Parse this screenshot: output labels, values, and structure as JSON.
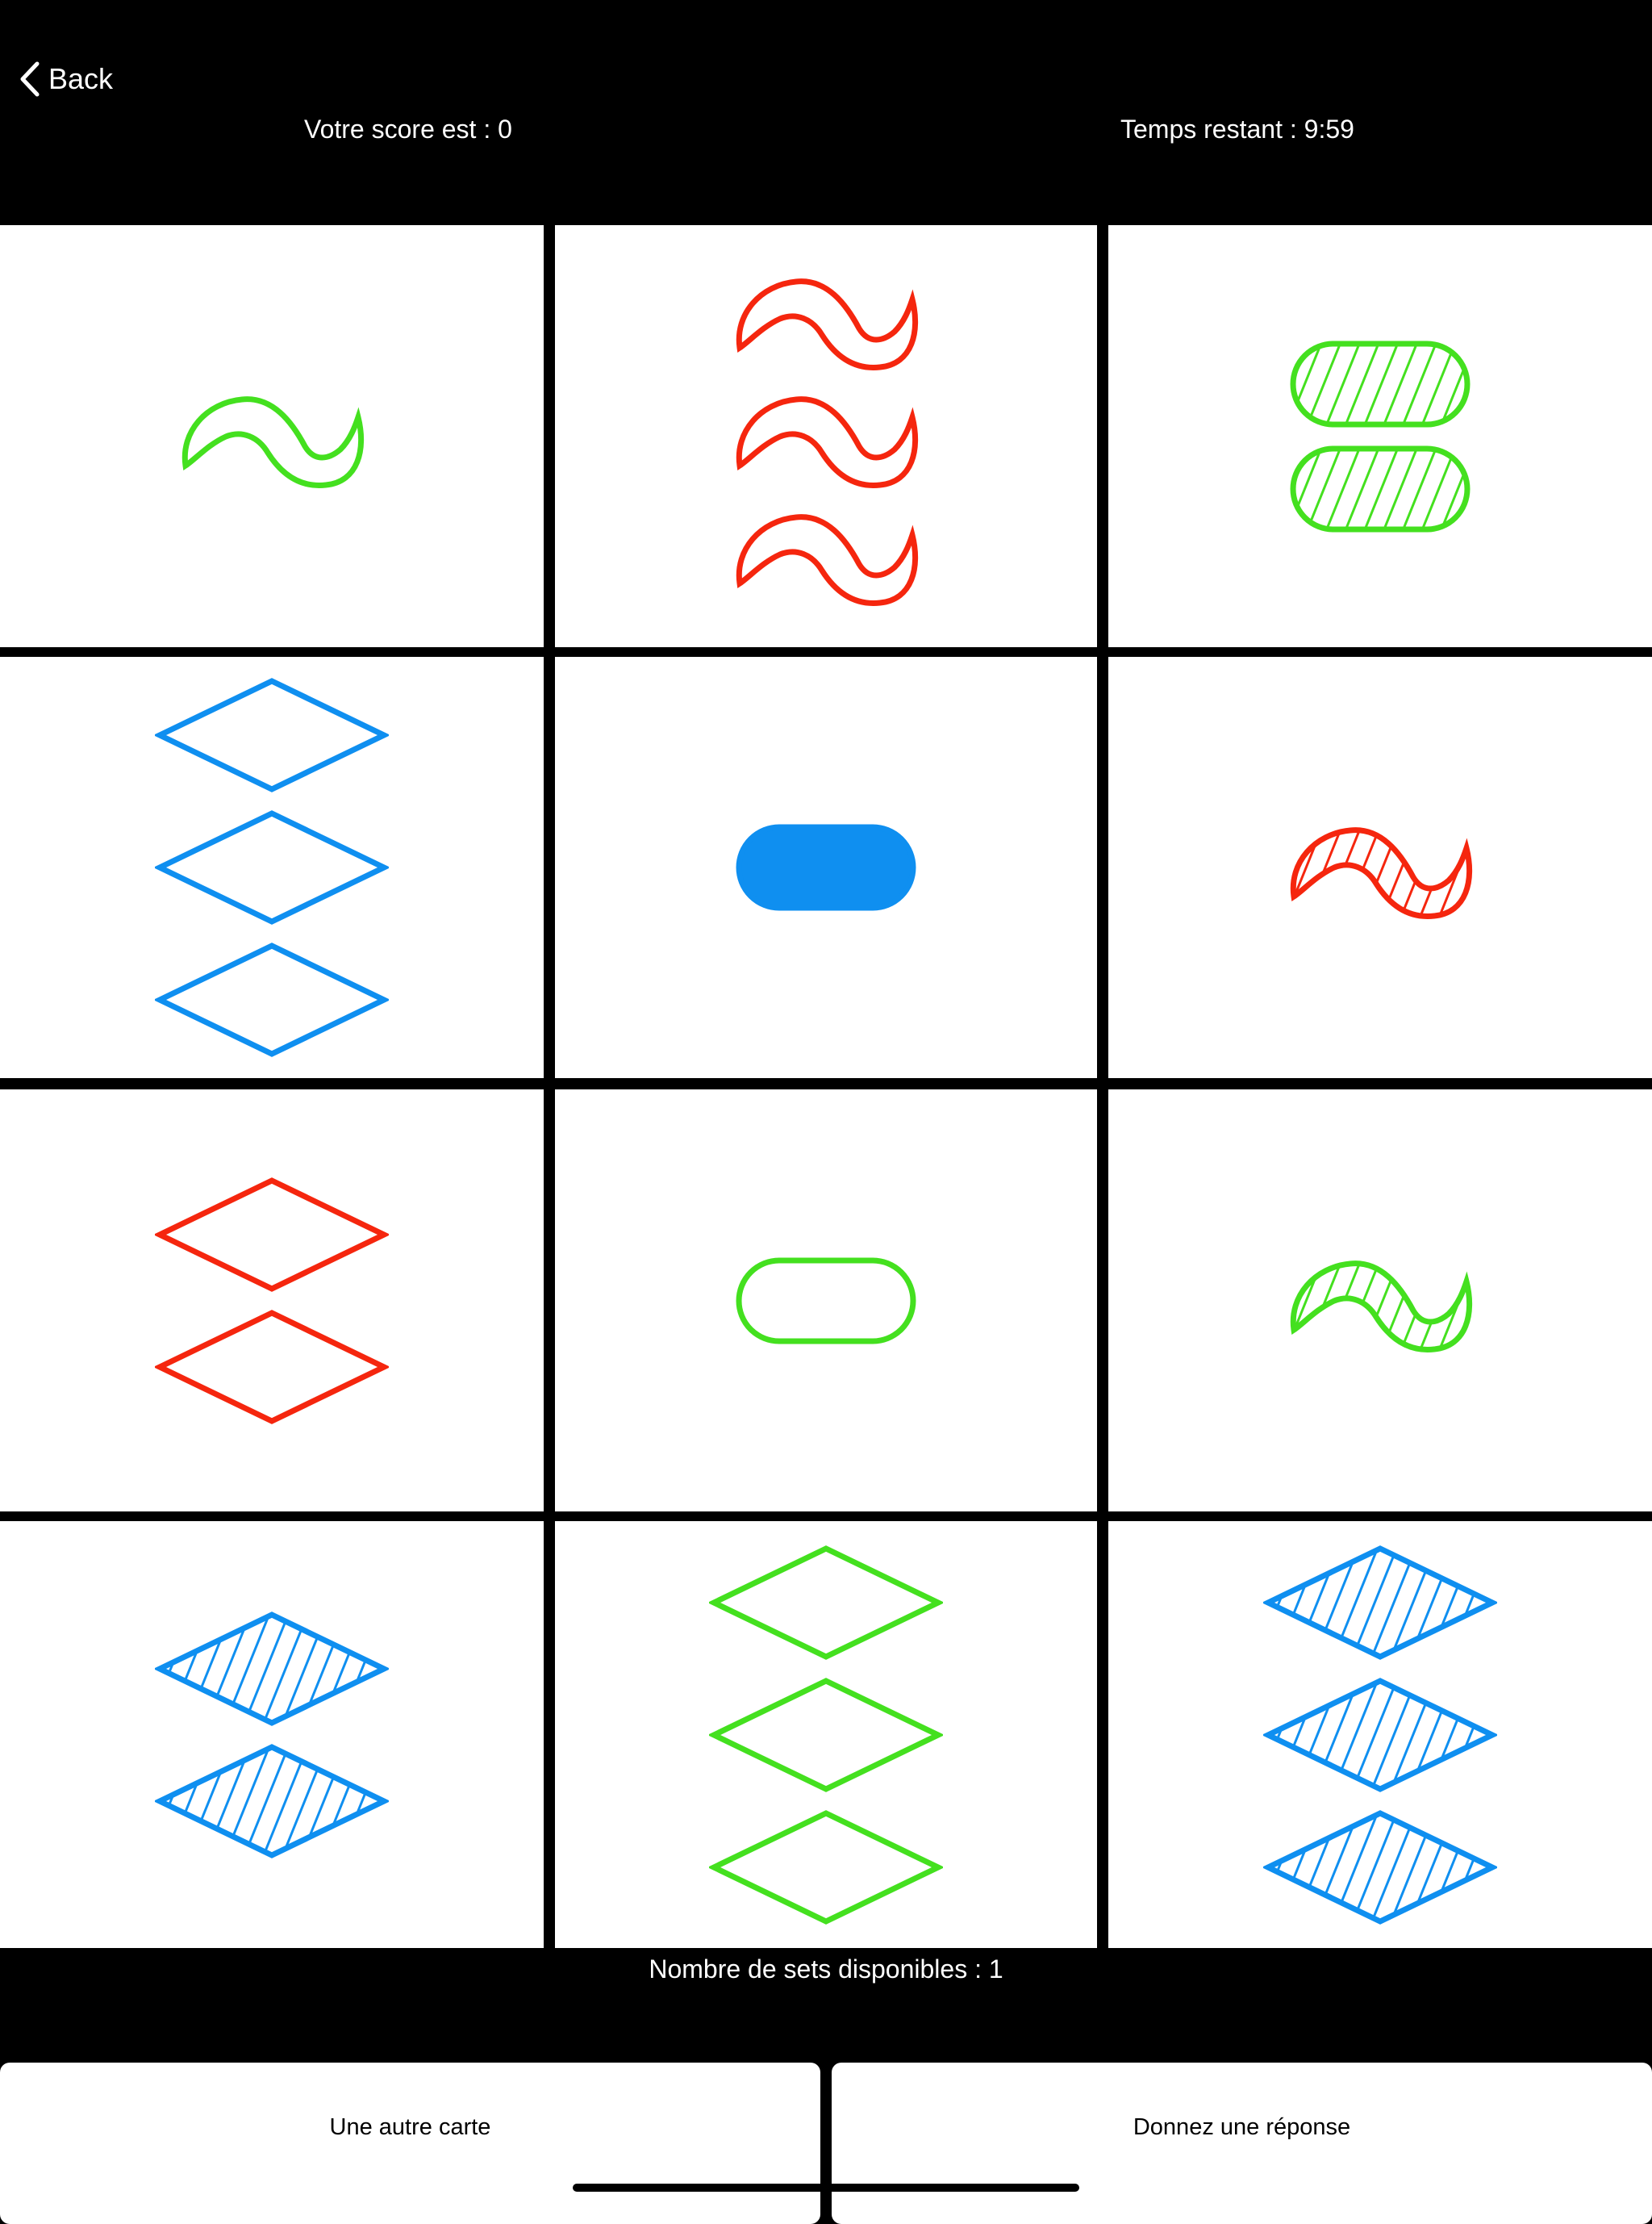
{
  "nav": {
    "back_label": "Back"
  },
  "header": {
    "score_text": "Votre score est : 0",
    "time_text": "Temps restant : 9:59"
  },
  "colors": {
    "green": "#44e01f",
    "red": "#f5260e",
    "blue": "#0f8ff0"
  },
  "cards": [
    {
      "count": 1,
      "shape": "squiggle",
      "color": "green",
      "fill": "open"
    },
    {
      "count": 3,
      "shape": "squiggle",
      "color": "red",
      "fill": "open"
    },
    {
      "count": 2,
      "shape": "oval",
      "color": "green",
      "fill": "striped"
    },
    {
      "count": 3,
      "shape": "diamond",
      "color": "blue",
      "fill": "open"
    },
    {
      "count": 1,
      "shape": "oval",
      "color": "blue",
      "fill": "solid"
    },
    {
      "count": 1,
      "shape": "squiggle",
      "color": "red",
      "fill": "striped"
    },
    {
      "count": 2,
      "shape": "diamond",
      "color": "red",
      "fill": "open"
    },
    {
      "count": 1,
      "shape": "oval",
      "color": "green",
      "fill": "open"
    },
    {
      "count": 1,
      "shape": "squiggle",
      "color": "green",
      "fill": "striped"
    },
    {
      "count": 2,
      "shape": "diamond",
      "color": "blue",
      "fill": "striped"
    },
    {
      "count": 3,
      "shape": "diamond",
      "color": "green",
      "fill": "open"
    },
    {
      "count": 3,
      "shape": "diamond",
      "color": "blue",
      "fill": "striped"
    }
  ],
  "status": {
    "sets_text": "Nombre de sets disponibles : 1"
  },
  "buttons": {
    "another_card": "Une autre carte",
    "answer": "Donnez une réponse"
  }
}
